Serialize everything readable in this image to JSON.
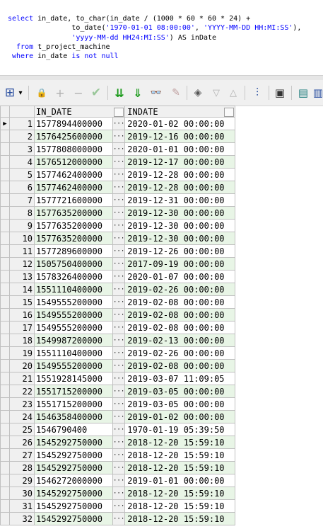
{
  "sql": {
    "l1a": "select",
    "l1b": " in_date, to_char(in_date / (1000 * 60 * 60 * 24) +",
    "l2a": "               to_date(",
    "l2b": "'1970-01-01 08:00:00'",
    "l2c": ", ",
    "l2d": "'YYYY-MM-DD HH:MI:SS'",
    "l2e": "),",
    "l3a": "               ",
    "l3b": "'yyyy-MM-dd HH24:MI:SS'",
    "l3c": ") AS inDate",
    "l4a": "  from",
    "l4b": " t_project_machine",
    "l5a": " where",
    "l5b": " in_date ",
    "l5c": "is not null"
  },
  "grid": {
    "headers": [
      "IN_DATE",
      "INDATE"
    ],
    "rows": [
      [
        "1",
        "1577894400000",
        "2020-01-02 00:00:00"
      ],
      [
        "2",
        "1576425600000",
        "2019-12-16 00:00:00"
      ],
      [
        "3",
        "1577808000000",
        "2020-01-01 00:00:00"
      ],
      [
        "4",
        "1576512000000",
        "2019-12-17 00:00:00"
      ],
      [
        "5",
        "1577462400000",
        "2019-12-28 00:00:00"
      ],
      [
        "6",
        "1577462400000",
        "2019-12-28 00:00:00"
      ],
      [
        "7",
        "1577721600000",
        "2019-12-31 00:00:00"
      ],
      [
        "8",
        "1577635200000",
        "2019-12-30 00:00:00"
      ],
      [
        "9",
        "1577635200000",
        "2019-12-30 00:00:00"
      ],
      [
        "10",
        "1577635200000",
        "2019-12-30 00:00:00"
      ],
      [
        "11",
        "1577289600000",
        "2019-12-26 00:00:00"
      ],
      [
        "12",
        "1505750400000",
        "2017-09-19 00:00:00"
      ],
      [
        "13",
        "1578326400000",
        "2020-01-07 00:00:00"
      ],
      [
        "14",
        "1551110400000",
        "2019-02-26 00:00:00"
      ],
      [
        "15",
        "1549555200000",
        "2019-02-08 00:00:00"
      ],
      [
        "16",
        "1549555200000",
        "2019-02-08 00:00:00"
      ],
      [
        "17",
        "1549555200000",
        "2019-02-08 00:00:00"
      ],
      [
        "18",
        "1549987200000",
        "2019-02-13 00:00:00"
      ],
      [
        "19",
        "1551110400000",
        "2019-02-26 00:00:00"
      ],
      [
        "20",
        "1549555200000",
        "2019-02-08 00:00:00"
      ],
      [
        "21",
        "1551928145000",
        "2019-03-07 11:09:05"
      ],
      [
        "22",
        "1551715200000",
        "2019-03-05 00:00:00"
      ],
      [
        "23",
        "1551715200000",
        "2019-03-05 00:00:00"
      ],
      [
        "24",
        "1546358400000",
        "2019-01-02 00:00:00"
      ],
      [
        "25",
        "1546790400",
        "1970-01-19 05:39:50"
      ],
      [
        "26",
        "1545292750000",
        "2018-12-20 15:59:10"
      ],
      [
        "27",
        "1545292750000",
        "2018-12-20 15:59:10"
      ],
      [
        "28",
        "1545292750000",
        "2018-12-20 15:59:10"
      ],
      [
        "29",
        "1546272000000",
        "2019-01-01 00:00:00"
      ],
      [
        "30",
        "1545292750000",
        "2018-12-20 15:59:10"
      ],
      [
        "31",
        "1545292750000",
        "2018-12-20 15:59:10"
      ],
      [
        "32",
        "1545292750000",
        "2018-12-20 15:59:10"
      ]
    ],
    "cell_button": "···",
    "current_row_marker": "▶"
  },
  "toolbar": {
    "icons": [
      "grid-select-icon",
      "dropdown-arrow-icon",
      "lock-icon",
      "add-record-icon",
      "delete-record-icon",
      "post-edit-icon",
      "fetch-next-icon",
      "fetch-last-icon",
      "find-icon",
      "clear-icon",
      "query-by-example-icon",
      "filter-icon",
      "sort-icon",
      "tree-icon",
      "save-icon",
      "export-icon",
      "extra-icon"
    ],
    "glyphs": {
      "grid": "⊞",
      "dropdown": "▾",
      "lock": "🔒",
      "add": "+",
      "del": "−",
      "post": "✔",
      "next": "⇊",
      "last": "⇓",
      "find": "👓",
      "clear": "✎",
      "qbe": "◈",
      "filter": "▽",
      "sort": "△",
      "tree": "⫶",
      "save": "▣",
      "export": "▤",
      "extra": "▥"
    },
    "colors": {
      "green": "#1a9a1a",
      "gray": "#b0b0b0",
      "blue": "#2a4fa0"
    }
  }
}
